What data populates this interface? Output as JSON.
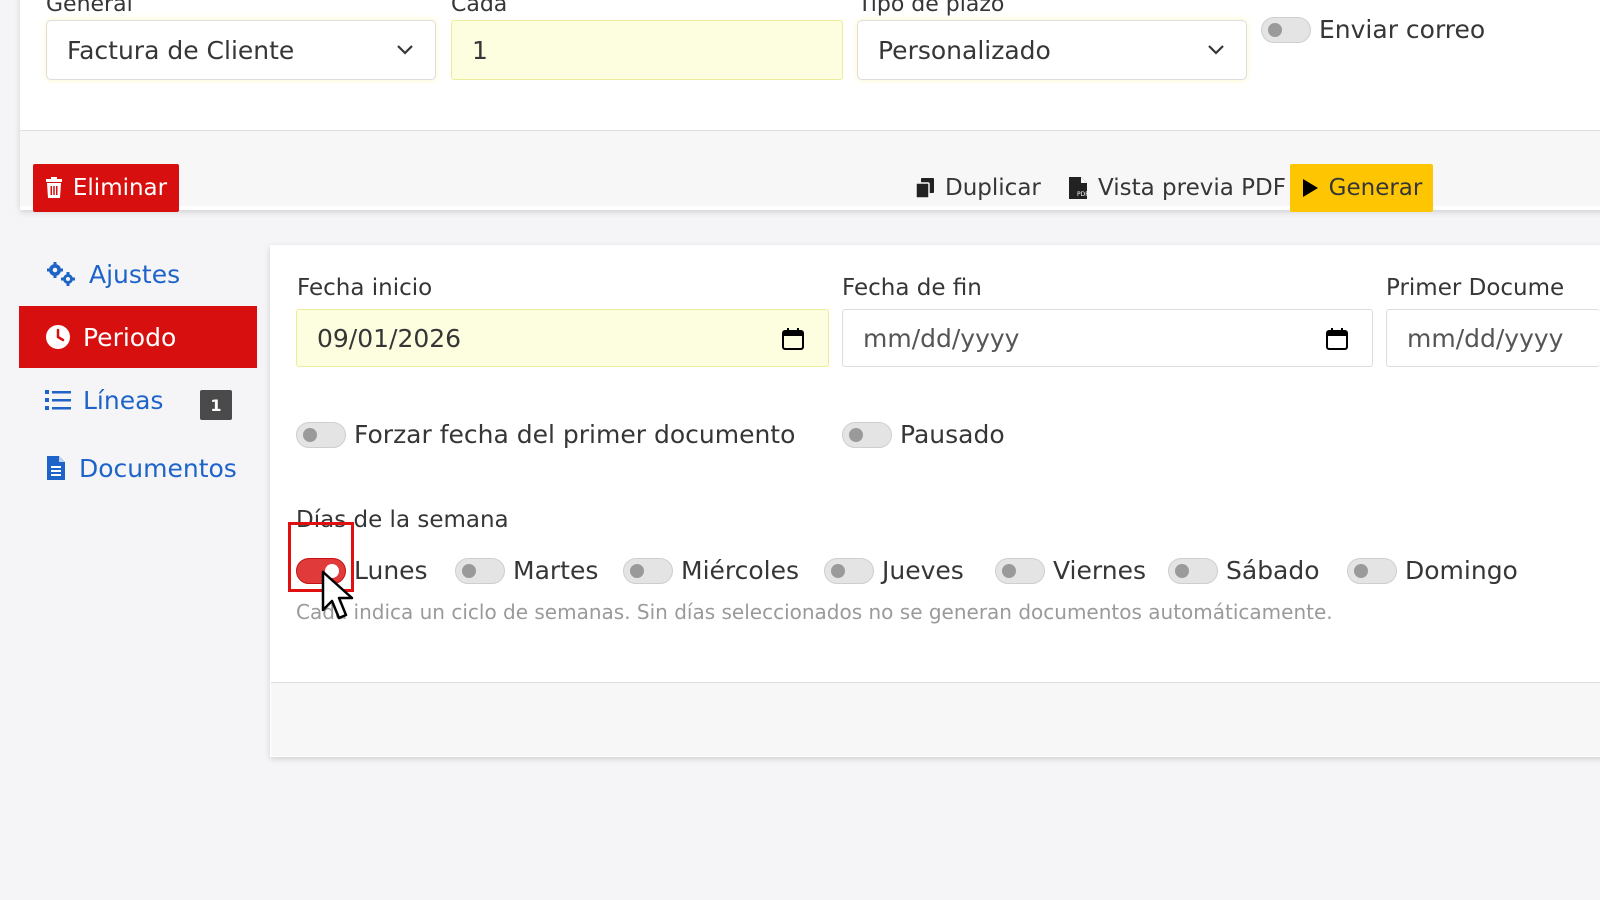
{
  "top": {
    "labels": {
      "general": "General",
      "cada": "Cada",
      "tipo_plazo": "Tipo de plazo"
    },
    "general_value": "Factura de Cliente",
    "cada_value": "1",
    "tipo_plazo_value": "Personalizado",
    "enviar_correo": "Enviar correo"
  },
  "actions": {
    "eliminar": "Eliminar",
    "duplicar": "Duplicar",
    "vista_previa": "Vista previa PDF",
    "generar": "Generar"
  },
  "sidebar": {
    "items": [
      {
        "label": "Ajustes",
        "icon": "gears-icon"
      },
      {
        "label": "Periodo",
        "icon": "clock-icon",
        "active": true
      },
      {
        "label": "Líneas",
        "icon": "list-icon",
        "badge": "1"
      },
      {
        "label": "Documentos",
        "icon": "document-icon"
      }
    ]
  },
  "period": {
    "fecha_inicio_label": "Fecha inicio",
    "fecha_inicio_value": "09/01/2026",
    "fecha_fin_label": "Fecha de fin",
    "fecha_fin_placeholder": "mm/dd/yyyy",
    "primer_doc_label": "Primer Docume",
    "primer_doc_placeholder": "mm/dd/yyyy",
    "forzar_label": "Forzar fecha del primer documento",
    "pausado_label": "Pausado",
    "dias_label": "Días de la semana",
    "days": [
      {
        "label": "Lunes",
        "on": true
      },
      {
        "label": "Martes",
        "on": false
      },
      {
        "label": "Miércoles",
        "on": false
      },
      {
        "label": "Jueves",
        "on": false
      },
      {
        "label": "Viernes",
        "on": false
      },
      {
        "label": "Sábado",
        "on": false
      },
      {
        "label": "Domingo",
        "on": false
      }
    ],
    "hint": "Cada indica un ciclo de semanas. Sin días seleccionados no se generan documentos automáticamente."
  },
  "colors": {
    "danger": "#d80f0f",
    "warning": "#fec602",
    "link": "#1e64c8"
  }
}
